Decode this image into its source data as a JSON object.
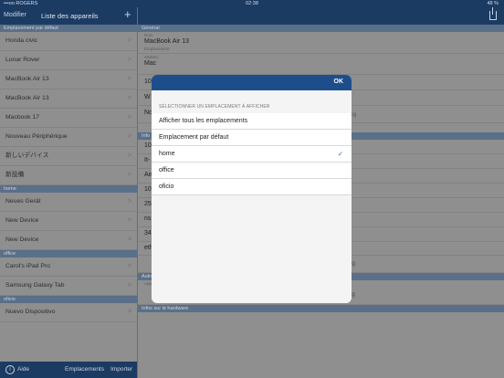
{
  "status_bar": {
    "carrier": "•••oo ROGERS",
    "time": "02:38",
    "battery": "48 %"
  },
  "left_nav": {
    "edit_label": "Modifier",
    "title": "Liste des appareils"
  },
  "sections": {
    "default": {
      "header": "Emplacement par défaut",
      "items": [
        "Honda civic",
        "Lunar Rover",
        "MacBook Air 13",
        "MacBook Air 13",
        "Macbook 17",
        "Nouveau Périphérique",
        "新しいデバイス",
        "新設備"
      ]
    },
    "home": {
      "header": "home",
      "items": [
        "Neues Gerät",
        "New Device",
        "New Device"
      ]
    },
    "office": {
      "header": "office",
      "items": [
        "Carol's iPad Pro",
        "Samsung Galaxy Tab"
      ]
    },
    "oficio": {
      "header": "oficio",
      "items": [
        "Nuevo Dispositivo"
      ]
    }
  },
  "left_toolbar": {
    "help_label": "Aide",
    "locations_label": "Emplacements",
    "import_label": "Importer"
  },
  "detail": {
    "general_header": "Général",
    "name_label": "Nom",
    "name_value": "MacBook Air 13",
    "location_label": "Emplacement",
    "status_label": "Statistic",
    "status_value": "Mac",
    "v3": "10",
    "v4": "W",
    "v5": "No",
    "info_header": "Info",
    "iv1": "10",
    "iv2": "It-",
    "iv3": "Air",
    "iv4": "10",
    "iv5": "25",
    "iv6": "ns",
    "iv7": "34",
    "eth_value": "eth1",
    "add_new_row_label": "Ajouter un Nouveau Reng",
    "add_row_label_2": "Ajouter un Nouveau Reng",
    "other_header": "Autre",
    "apps_label": "Applications",
    "hardware_header": "Infos sur le hardware",
    "faded_text": "ng"
  },
  "modal": {
    "ok_label": "OK",
    "hint": "SÉLECTIONNER UN EMPLACEMENT À AFFICHER",
    "options": [
      "Afficher tous les emplacements",
      "Emplacement par défaut",
      "home",
      "office",
      "oficio"
    ],
    "selected_option": "home"
  },
  "icons": {
    "add": "plus-icon",
    "info": "info-icon",
    "share": "share-icon",
    "check": "checkmark-icon",
    "chevron": "chevron-right-icon"
  },
  "colors": {
    "nav": "#1c3b63",
    "modal_bar": "#1d4e8b",
    "section_header": "#5a6f88",
    "check": "#2c6fd1"
  }
}
